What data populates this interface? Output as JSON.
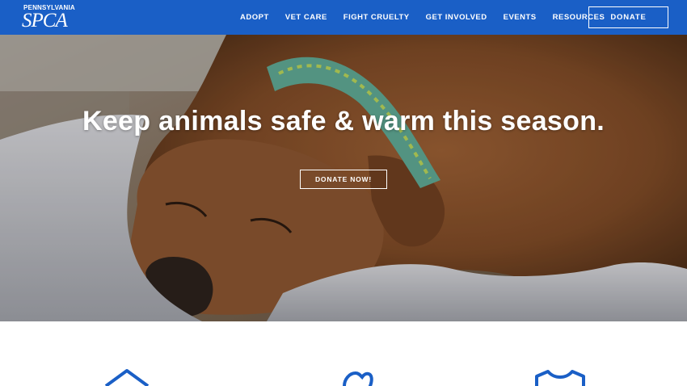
{
  "logo": {
    "top_text": "PENNSYLVANIA",
    "main_text": "SPCA"
  },
  "nav": {
    "items": [
      {
        "label": "ADOPT"
      },
      {
        "label": "VET CARE"
      },
      {
        "label": "FIGHT CRUELTY"
      },
      {
        "label": "GET INVOLVED"
      },
      {
        "label": "EVENTS"
      },
      {
        "label": "RESOURCES"
      }
    ],
    "donate_label": "DONATE"
  },
  "hero": {
    "title": "Keep animals safe & warm this season.",
    "button_label": "DONATE NOW!"
  },
  "colors": {
    "brand_blue": "#1a5fc6"
  },
  "icons": [
    "house-icon",
    "heart-hand-icon",
    "shirt-icon"
  ]
}
